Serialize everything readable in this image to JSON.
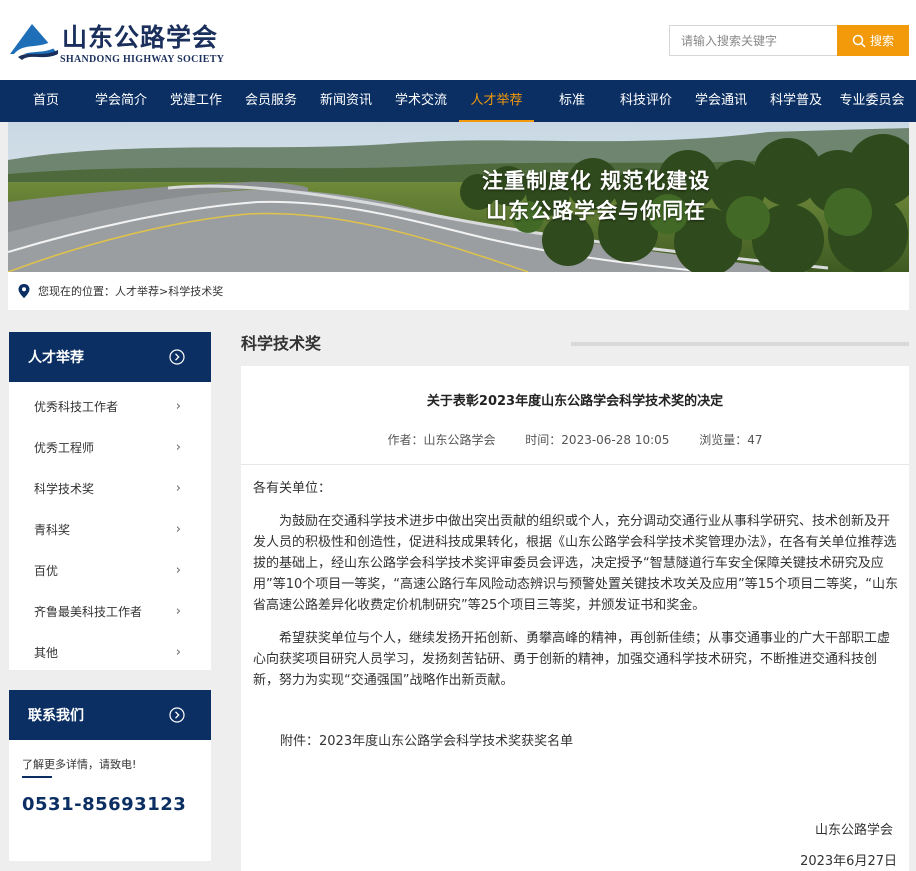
{
  "site": {
    "logo_cn": "山东公路学会",
    "logo_en": "SHANDONG HIGHWAY SOCIETY"
  },
  "search": {
    "placeholder": "请输入搜索关键字",
    "button": "搜索"
  },
  "nav": {
    "items": [
      "首页",
      "学会简介",
      "党建工作",
      "会员服务",
      "新闻资讯",
      "学术交流",
      "人才举荐",
      "标准",
      "科技评价",
      "学会通讯",
      "科学普及",
      "专业委员会"
    ],
    "active": "人才举荐"
  },
  "banner": {
    "line1": "注重制度化 规范化建设",
    "line2": "山东公路学会与你同在"
  },
  "breadcrumb": {
    "prefix": "您现在的位置：",
    "level1": "人才举荐",
    "sep": ">",
    "level2": "科学技术奖"
  },
  "sidebar": {
    "title": "人才举荐",
    "items": [
      "优秀科技工作者",
      "优秀工程师",
      "科学技术奖",
      "青科奖",
      "百优",
      "齐鲁最美科技工作者",
      "其他"
    ],
    "chevron": "›"
  },
  "contact": {
    "title": "联系我们",
    "note": "了解更多详情，请致电!",
    "phone": "0531-85693123"
  },
  "section": {
    "title": "科学技术奖"
  },
  "article": {
    "title": "关于表彰2023年度山东公路学会科学技术奖的决定",
    "author": "作者：山东公路学会",
    "time": "时间：2023-06-28 10:05",
    "views": "浏览量：47",
    "greeting": "各有关单位：",
    "para1": "为鼓励在交通科学技术进步中做出突出贡献的组织或个人，充分调动交通行业从事科学研究、技术创新及开发人员的积极性和创造性，促进科技成果转化，根据《山东公路学会科学技术奖管理办法》，在各有关单位推荐选拔的基础上，经山东公路学会科学技术奖评审委员会评选，决定授予“智慧隧道行车安全保障关键技术研究及应用”等10个项目一等奖，“高速公路行车风险动态辨识与预警处置关键技术攻关及应用”等15个项目二等奖，“山东省高速公路差异化收费定价机制研究”等25个项目三等奖，并颁发证书和奖金。",
    "para2": "希望获奖单位与个人，继续发扬开拓创新、勇攀高峰的精神，再创新佳绩；从事交通事业的广大干部职工虚心向获奖项目研究人员学习，发扬刻苦钻研、勇于创新的精神，加强交通科学技术研究，不断推进交通科技创新，努力为实现“交通强国”战略作出新贡献。",
    "attachment": "附件：2023年度山东公路学会科学技术奖获奖名单",
    "sign_org": "山东公路学会",
    "sign_date": "2023年6月27日"
  },
  "colors": {
    "nav_bg": "#0b2f63",
    "accent": "#f29a0a"
  }
}
